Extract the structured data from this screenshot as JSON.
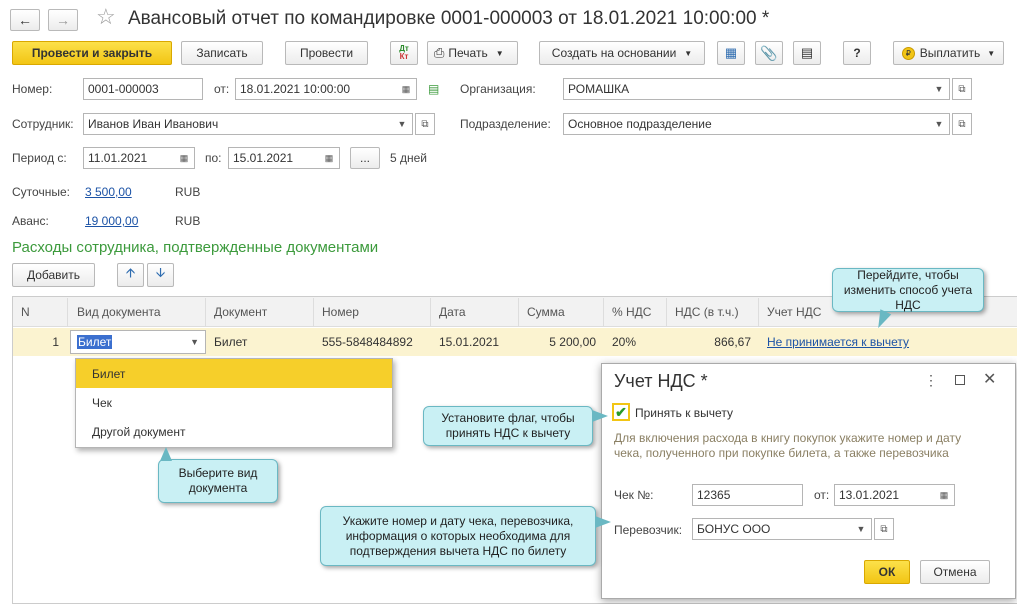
{
  "window": {
    "title": "Авансовый отчет по командировке 0001-000003 от 18.01.2021 10:00:00 *"
  },
  "toolbar": {
    "post_close": "Провести и закрыть",
    "save": "Записать",
    "post": "Провести",
    "dtkt": "Дт Кт",
    "print": "Печать",
    "create_based": "Создать на основании",
    "help": "?",
    "pay": "Выплатить"
  },
  "form": {
    "number_label": "Номер:",
    "number_value": "0001-000003",
    "from_label": "от:",
    "from_value": "18.01.2021 10:00:00",
    "org_label": "Организация:",
    "org_value": "РОМАШКА",
    "employee_label": "Сотрудник:",
    "employee_value": "Иванов Иван Иванович",
    "dept_label": "Подразделение:",
    "dept_value": "Основное подразделение",
    "period_label": "Период с:",
    "period_from": "11.01.2021",
    "period_to_label": "по:",
    "period_to": "15.01.2021",
    "period_more": "...",
    "days": "5 дней",
    "daily_label": "Суточные:",
    "daily_value": "3 500,00",
    "daily_cur": "RUB",
    "advance_label": "Аванс:",
    "advance_value": "19 000,00",
    "advance_cur": "RUB"
  },
  "section": {
    "title": "Расходы сотрудника, подтвержденные документами",
    "add": "Добавить"
  },
  "table": {
    "headers": [
      "N",
      "Вид документа",
      "Документ",
      "Номер",
      "Дата",
      "Сумма",
      "% НДС",
      "НДС (в т.ч.)",
      "Учет НДС"
    ],
    "row": {
      "n": "1",
      "kind": "Билет",
      "doc": "Билет",
      "number": "555-5848484892",
      "date": "15.01.2021",
      "sum": "5 200,00",
      "vat_rate": "20%",
      "vat": "866,67",
      "vat_accounting": "Не принимается к вычету"
    }
  },
  "dropdown": {
    "options": [
      "Билет",
      "Чек",
      "Другой документ"
    ],
    "selected": "Билет"
  },
  "dialog": {
    "title": "Учет НДС *",
    "checkbox_label": "Принять к вычету",
    "hint": "Для включения расхода в книгу покупок укажите номер и дату чека, полученного при покупке билета, а также перевозчика",
    "check_label": "Чек №:",
    "check_value": "12365",
    "check_from_label": "от:",
    "check_date": "13.01.2021",
    "carrier_label": "Перевозчик:",
    "carrier_value": "БОНУС ООО",
    "ok": "ОК",
    "cancel": "Отмена"
  },
  "callouts": {
    "vat_link": "Перейдите, чтобы изменить способ учета НДС",
    "checkbox": "Установите флаг, чтобы принять НДС к вычету",
    "doc_kind": "Выберите вид документа",
    "receipt": "Укажите номер и дату чека, перевозчика, информация о которых необходима для подтверждения вычета НДС по билету"
  },
  "colors": {
    "accent_yellow": "#f6cf2a",
    "row_highlight": "#fbf3d0",
    "section_green": "#3c9a3c",
    "link": "#1c53a6",
    "callout": "#c9f0f4"
  }
}
